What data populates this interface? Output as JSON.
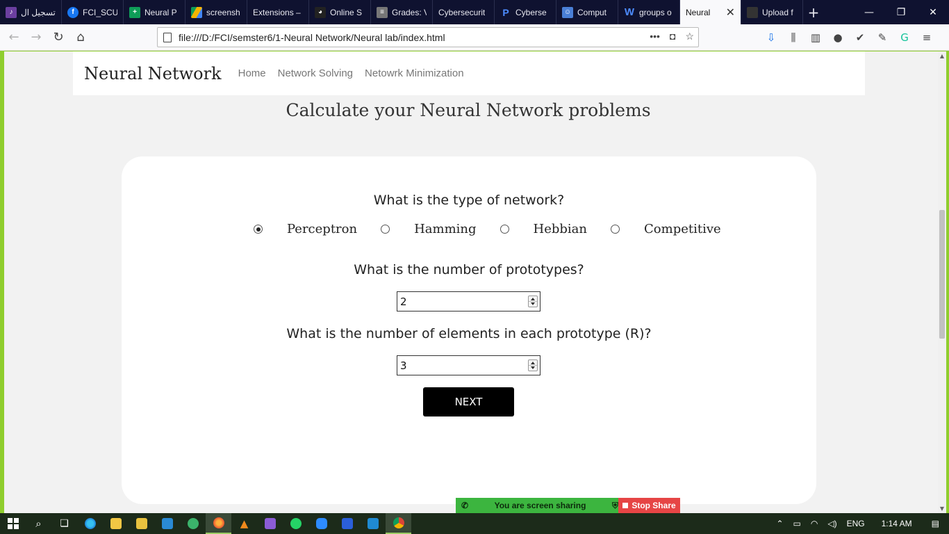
{
  "browser": {
    "tabs": [
      {
        "label": "تسجيل ال",
        "icon": "generic-favicon-icon",
        "color": "#6b3fa0"
      },
      {
        "label": "FCI_SCU",
        "icon": "facebook-icon",
        "color": "#1877f2"
      },
      {
        "label": "Neural P",
        "icon": "sheets-icon",
        "color": "#0f9d58"
      },
      {
        "label": "screensh",
        "icon": "drive-icon",
        "color": "#f4b400"
      },
      {
        "label": "Extensions –",
        "icon": "none",
        "color": ""
      },
      {
        "label": "Online S",
        "icon": "spy-icon",
        "color": "#222"
      },
      {
        "label": "Grades: V",
        "icon": "grades-icon",
        "color": "#888"
      },
      {
        "label": "Cybersecurit",
        "icon": "none",
        "color": ""
      },
      {
        "label": "Cyberse",
        "icon": "p-icon",
        "color": "#2d6cdf"
      },
      {
        "label": "Comput",
        "icon": "contacts-icon",
        "color": "#4a7fd6"
      },
      {
        "label": "groups o",
        "icon": "w-icon",
        "color": "#2b5fd9"
      },
      {
        "label": "Neural",
        "icon": "none",
        "color": "",
        "active": true
      },
      {
        "label": "Upload f",
        "icon": "generic-favicon-icon",
        "color": "#333"
      }
    ],
    "url": "file:///D:/FCI/semster6/1-Neural Network/Neural lab/index.html"
  },
  "site": {
    "brand": "Neural Network",
    "nav": [
      "Home",
      "Network Solving",
      "Netowrk Minimization"
    ],
    "heading": "Calculate your Neural Network problems"
  },
  "form": {
    "q_type": "What is the type of network?",
    "network_types": [
      "Perceptron",
      "Hamming",
      "Hebbian",
      "Competitive"
    ],
    "selected_type": "Perceptron",
    "q_prototypes": "What is the number of prototypes?",
    "prototypes_value": "2",
    "q_elements": "What is the number of elements in each prototype (R)?",
    "elements_value": "3",
    "next_label": "NEXT"
  },
  "share_bar": {
    "message": "You are screen sharing",
    "stop_label": "Stop Share"
  },
  "taskbar": {
    "language": "ENG",
    "time": "1:14 AM"
  }
}
